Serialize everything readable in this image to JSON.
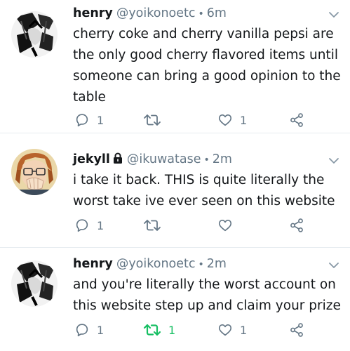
{
  "tweets": [
    {
      "name": "henry",
      "handle": "@yoikonoetc",
      "separator": "•",
      "time": "6m",
      "text": "cherry coke and cherry vanilla pepsi are the only good cherry flavored items until someone can bring a good opinion to the table",
      "replies": "1",
      "retweets": "",
      "likes": "1",
      "retweeted": false,
      "locked": false
    },
    {
      "name": "jekyll",
      "handle": "@ikuwatase",
      "separator": "•",
      "time": "2m",
      "text": "i take it back. THIS is quite literally the worst take ive ever seen on this website",
      "replies": "1",
      "retweets": "",
      "likes": "",
      "retweeted": false,
      "locked": true
    },
    {
      "name": "henry",
      "handle": "@yoikonoetc",
      "separator": "•",
      "time": "2m",
      "text": "and you're literally the worst account on this website step up and claim your prize",
      "replies": "1",
      "retweets": "1",
      "likes": "1",
      "retweeted": true,
      "locked": false
    }
  ],
  "colors": {
    "text": "#14171a",
    "secondary": "#657786",
    "icon": "#657786",
    "retweet_active": "#17bf63",
    "divider": "#e6ecf0"
  },
  "icons": [
    "reply-icon",
    "retweet-icon",
    "like-icon",
    "share-icon",
    "caret-down-icon",
    "lock-icon"
  ]
}
